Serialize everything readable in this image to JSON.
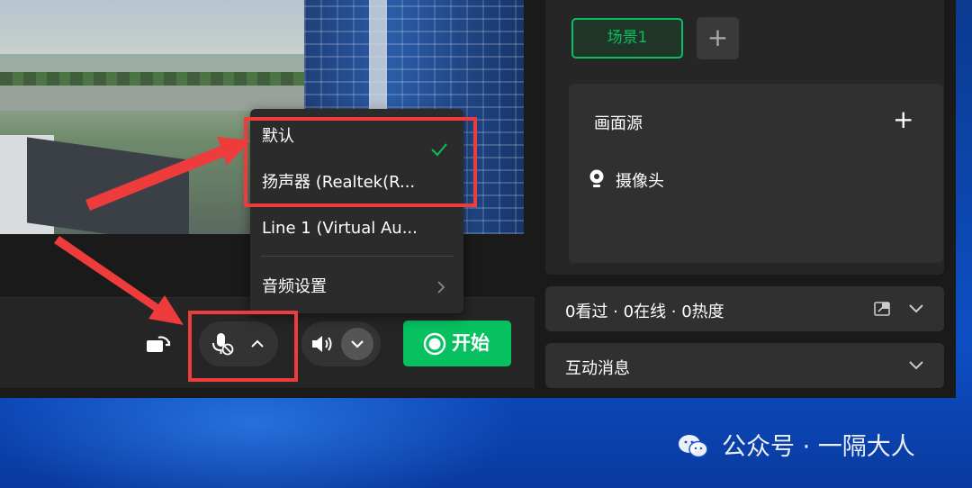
{
  "colors": {
    "accent_green": "#07c160",
    "highlight_red": "#ee3b3b",
    "panel_bg": "#262626",
    "app_bg": "#1a1a1a"
  },
  "controls": {
    "rotate_icon": "rotate-icon",
    "mic_icon": "mic-muted-icon",
    "mic_chevron": "^",
    "speaker_icon": "speaker-icon",
    "speaker_chevron": "⌄",
    "start_label": "开始",
    "start_icon": "record-icon"
  },
  "mic_menu": {
    "items": [
      {
        "label": "默认",
        "selected": true
      },
      {
        "label": "扬声器 (Realtek(R..."
      },
      {
        "label": "Line 1 (Virtual Au..."
      }
    ],
    "settings_label": "音频设置"
  },
  "scenes": {
    "tabs": [
      {
        "label": "场景1",
        "active": true
      }
    ],
    "add_label": "+"
  },
  "sources": {
    "title": "画面源",
    "add_label": "+",
    "items": [
      {
        "label": "摄像头",
        "icon": "camera-icon"
      }
    ]
  },
  "stats": {
    "text": "0看过 · 0在线 · 0热度"
  },
  "messages": {
    "title": "互动消息"
  },
  "watermark": {
    "text": "公众号 · 一隔大人",
    "icon": "wechat-icon"
  }
}
